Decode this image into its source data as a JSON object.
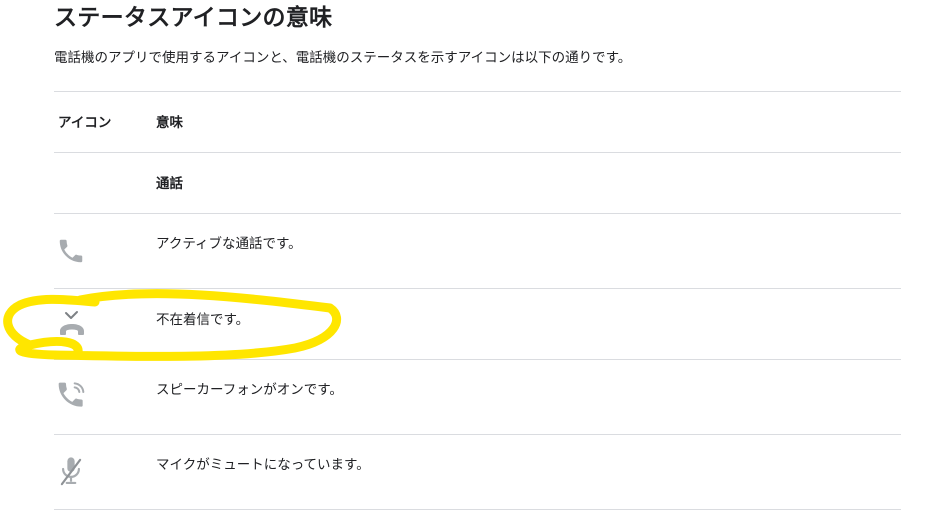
{
  "page": {
    "title": "ステータスアイコンの意味",
    "intro": "電話機のアプリで使用するアイコンと、電話機のステータスを示すアイコンは以下の通りです。"
  },
  "table": {
    "headers": {
      "icon": "アイコン",
      "meaning": "意味"
    },
    "section_label": "通話",
    "rows": [
      {
        "icon": "phone-icon",
        "meaning": "アクティブな通話です。"
      },
      {
        "icon": "missed-call-icon",
        "meaning": "不在着信です。"
      },
      {
        "icon": "speakerphone-icon",
        "meaning": "スピーカーフォンがオンです。"
      },
      {
        "icon": "mic-muted-icon",
        "meaning": "マイクがミュートになっています。"
      }
    ]
  },
  "colors": {
    "icon_gray": "#9aa0a6",
    "divider": "#dadce0",
    "highlight_yellow": "#ffe600"
  }
}
